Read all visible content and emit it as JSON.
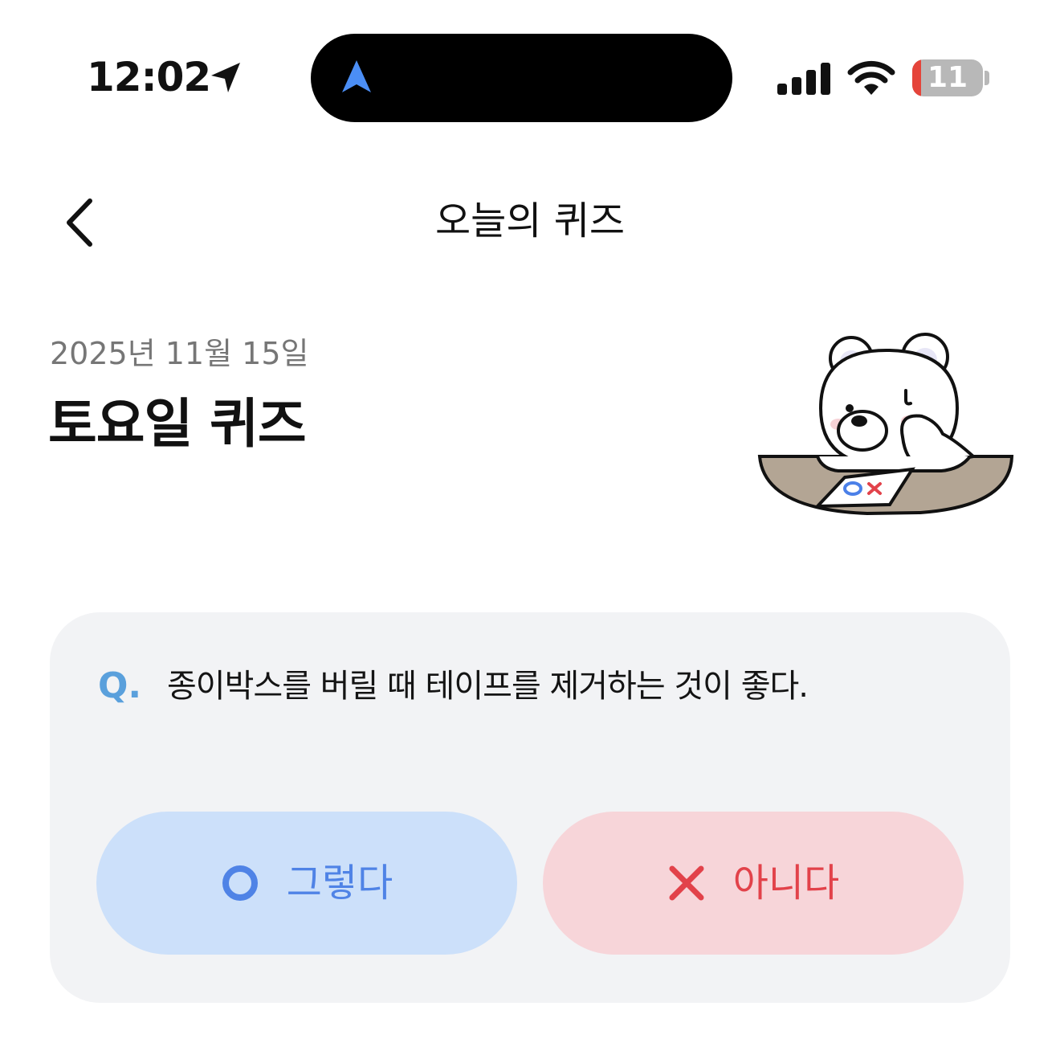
{
  "status_bar": {
    "time": "12:02",
    "battery_level": "11",
    "icons": [
      "location-arrow-icon",
      "navigation-icon",
      "signal-icon",
      "wifi-icon",
      "battery-icon"
    ]
  },
  "header": {
    "title": "오늘의 퀴즈",
    "back_icon": "chevron-left-icon"
  },
  "quiz": {
    "date": "2025년 11월 15일",
    "title": "토요일 퀴즈",
    "question_prefix": "Q.",
    "question": "종이박스를 버릴 때 테이프를 제거하는 것이 좋다."
  },
  "answers": {
    "yes_label": "그렇다",
    "yes_icon": "circle-o-icon",
    "no_label": "아니다",
    "no_icon": "x-icon"
  },
  "colors": {
    "card_bg": "#f2f3f5",
    "yes_bg": "#cce0fa",
    "yes_fg": "#4f83e6",
    "no_bg": "#f7d5d9",
    "no_fg": "#e2424a",
    "q_accent": "#5aa0dc",
    "date_text": "#767676",
    "battery_red": "#e5443a"
  }
}
